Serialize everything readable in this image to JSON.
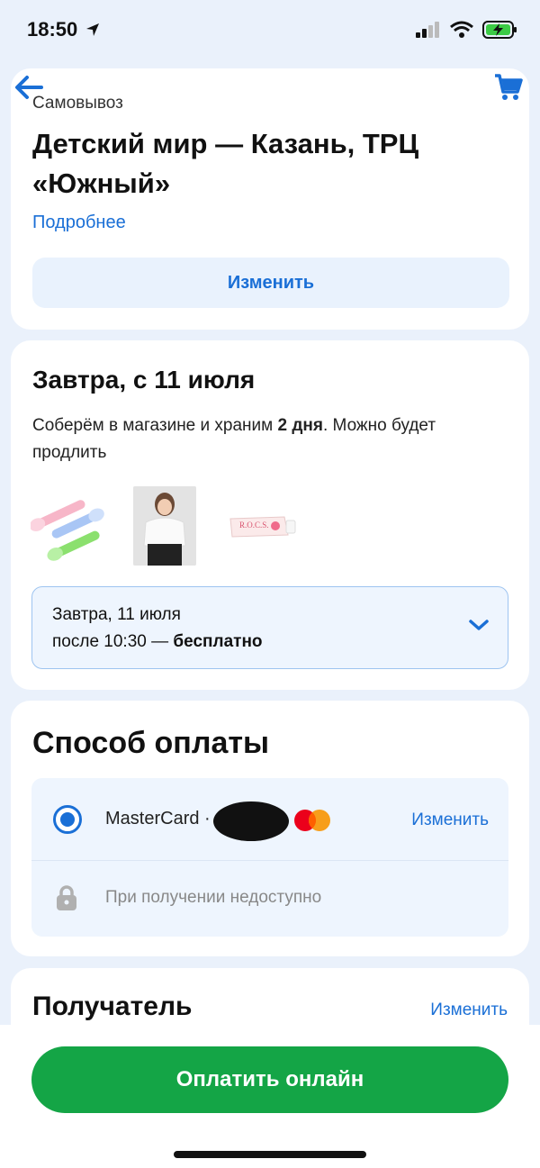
{
  "status_bar": {
    "time": "18:50"
  },
  "pickup": {
    "label": "Самовывоз",
    "store_title": "Детский мир — Казань, ТРЦ «Южный»",
    "more_link": "Подробнее",
    "change_button": "Изменить"
  },
  "delivery": {
    "date_title": "Завтра, с 11 июля",
    "collect_text_before": "Соберём в магазине и храним ",
    "collect_text_bold": "2 дня",
    "collect_text_after": ". Можно будет продлить",
    "selected_date": "Завтра, 11 июля",
    "selected_time": "после 10:30 — ",
    "selected_price": "бесплатно"
  },
  "payment": {
    "title": "Способ оплаты",
    "card_name": "MasterCard ·",
    "change_link": "Изменить",
    "unavailable_text": "При получении недоступно"
  },
  "recipient": {
    "title": "Получатель",
    "change_link": "Изменить"
  },
  "footer": {
    "pay_button": "Оплатить онлайн"
  },
  "colors": {
    "accent": "#1a6fd6",
    "primary_button": "#14a546",
    "background": "#eaf1fb"
  }
}
